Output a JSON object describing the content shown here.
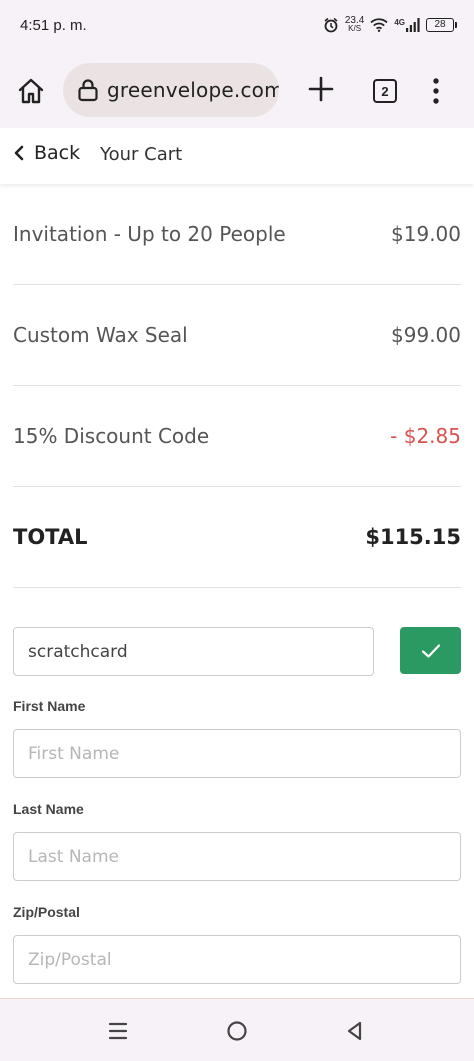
{
  "status": {
    "time": "4:51 p. m.",
    "net_speed": "23.4",
    "net_unit": "K/S",
    "network": "4G",
    "battery": "28"
  },
  "browser": {
    "url": "greenvelope.com",
    "tab_count": "2"
  },
  "header": {
    "back_label": "Back",
    "title": "Your Cart"
  },
  "cart": {
    "items": [
      {
        "name": "Invitation - Up to 20 People",
        "price": "$19.00"
      },
      {
        "name": "Custom Wax Seal",
        "price": "$99.00"
      },
      {
        "name": "15% Discount Code",
        "price": "- $2.85"
      }
    ],
    "total_label": "TOTAL",
    "total_value": "$115.15"
  },
  "promo": {
    "value": "scratchcard"
  },
  "form": {
    "first_name": {
      "label": "First Name",
      "placeholder": "First Name"
    },
    "last_name": {
      "label": "Last Name",
      "placeholder": "Last Name"
    },
    "zip": {
      "label": "Zip/Postal",
      "placeholder": "Zip/Postal"
    }
  },
  "colors": {
    "accent_green": "#2b9a62",
    "discount_red": "#d9534f"
  },
  "icons": {
    "home": "home-icon",
    "lock": "lock-icon",
    "plus": "plus-icon",
    "menu": "more-vert-icon",
    "back": "chevron-left-icon",
    "check": "check-icon",
    "nav_recents": "recents-icon",
    "nav_home": "home-circle-icon",
    "nav_back": "back-triangle-icon"
  }
}
